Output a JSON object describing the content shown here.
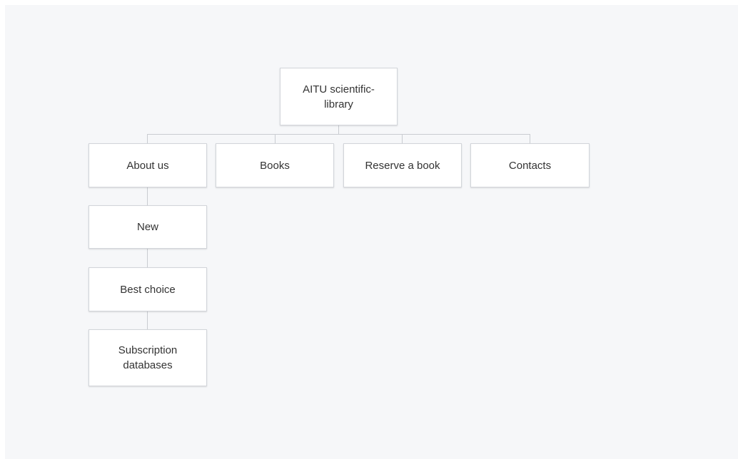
{
  "diagram": {
    "root": {
      "label": "AITU scientific-\nlibrary"
    },
    "top_level": [
      {
        "label": "About us"
      },
      {
        "label": "Books"
      },
      {
        "label": "Reserve a book"
      },
      {
        "label": "Contacts"
      }
    ],
    "about_children": [
      {
        "label": "New"
      },
      {
        "label": "Best choice"
      },
      {
        "label": "Subscription databases"
      }
    ]
  },
  "colors": {
    "canvas_background": "#f6f7f9",
    "node_background": "#ffffff",
    "node_border": "#d2d5da",
    "connector": "#c9ccd1",
    "text": "#333333"
  }
}
